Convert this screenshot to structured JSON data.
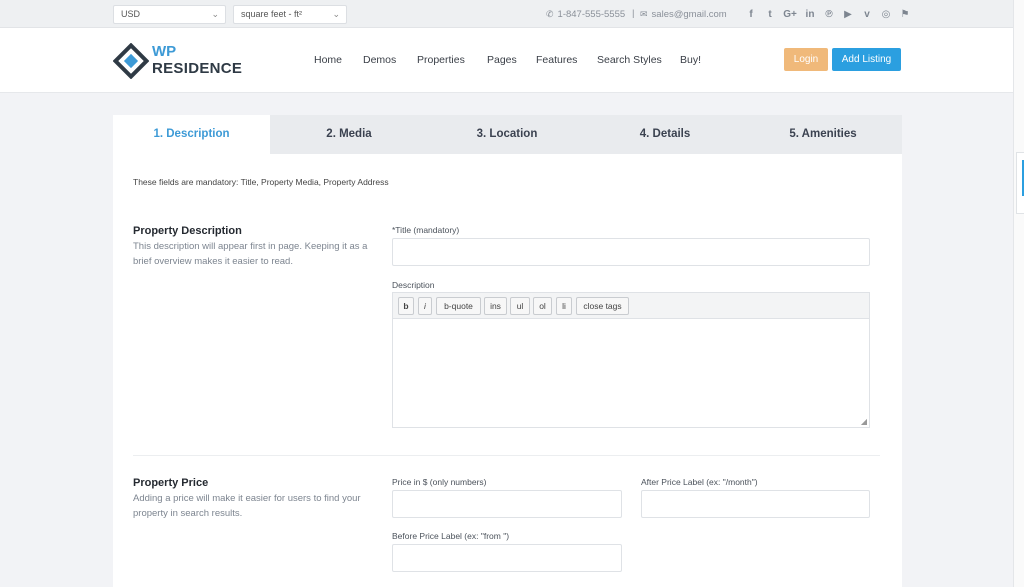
{
  "topbar": {
    "currency": "USD",
    "area_unit": "square feet - ft²",
    "phone": "1-847-555-5555",
    "separator": "|",
    "email": "sales@gmail.com",
    "social_icons": [
      "facebook-icon",
      "twitter-icon",
      "google-plus-icon",
      "linkedin-icon",
      "pinterest-icon",
      "youtube-icon",
      "vimeo-icon",
      "instagram-icon",
      "foursquare-icon"
    ]
  },
  "header": {
    "logo_line1": "WP",
    "logo_line2": "RESIDENCE",
    "nav": [
      "Home",
      "Demos",
      "Properties",
      "Pages",
      "Features",
      "Search Styles",
      "Buy!"
    ],
    "login_label": "Login",
    "add_listing_label": "Add Listing"
  },
  "tabs": [
    "1. Description",
    "2. Media",
    "3. Location",
    "4. Details",
    "5. Amenities"
  ],
  "active_tab": 0,
  "mandatory_note": "These fields are mandatory: Title, Property Media, Property Address",
  "description_section": {
    "title": "Property Description",
    "desc": "This description will appear first in page. Keeping it as a brief overview makes it easier to read.",
    "title_label": "*Title (mandatory)",
    "title_value": "",
    "description_label": "Description",
    "toolbar": [
      "b",
      "i",
      "b-quote",
      "ins",
      "ul",
      "ol",
      "li",
      "close tags"
    ],
    "description_value": ""
  },
  "price_section": {
    "title": "Property Price",
    "desc": "Adding a price will make it easier for users to find your property in search results.",
    "price_label": "Price in $ (only numbers)",
    "after_label": "After Price Label (ex: \"/month\")",
    "before_label": "Before Price Label (ex: \"from \")"
  },
  "colors": {
    "accent": "#2b9fe0",
    "login": "#f0b97a",
    "tab_active_text": "#3d9ad6"
  }
}
